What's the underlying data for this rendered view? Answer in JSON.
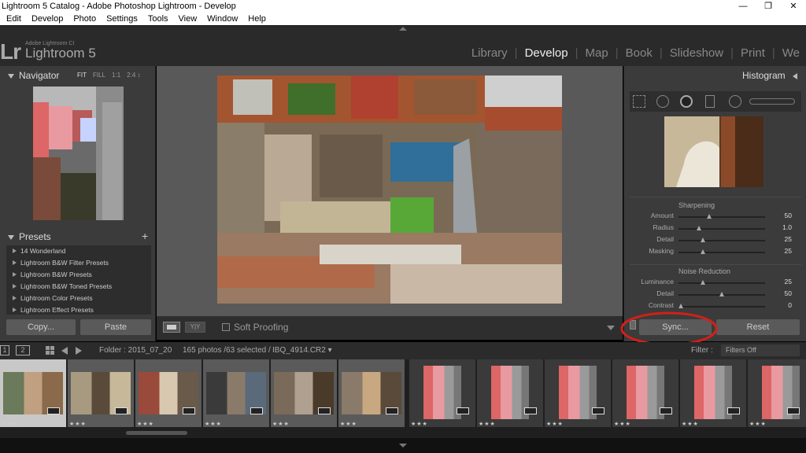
{
  "window": {
    "title": "Lightroom 5 Catalog - Adobe Photoshop Lightroom - Develop",
    "minimize": "—",
    "maximize": "❐",
    "close": "✕"
  },
  "menu": [
    "Edit",
    "Develop",
    "Photo",
    "Settings",
    "Tools",
    "View",
    "Window",
    "Help"
  ],
  "app": {
    "logo": "Lr",
    "small": "Adobe Lightroom CI",
    "name": "Lightroom 5"
  },
  "modules": [
    {
      "label": "Library",
      "active": false
    },
    {
      "label": "Develop",
      "active": true
    },
    {
      "label": "Map",
      "active": false
    },
    {
      "label": "Book",
      "active": false
    },
    {
      "label": "Slideshow",
      "active": false
    },
    {
      "label": "Print",
      "active": false
    },
    {
      "label": "We",
      "active": false
    }
  ],
  "navigator": {
    "title": "Navigator",
    "zoom": [
      "FIT",
      "FILL",
      "1:1",
      "2:4 ↕"
    ]
  },
  "presets": {
    "title": "Presets",
    "add": "+",
    "items": [
      "14 Wonderland",
      "Lightroom B&W Filter Presets",
      "Lightroom B&W Presets",
      "Lightroom B&W Toned Presets",
      "Lightroom Color Presets",
      "Lightroom Effect Presets"
    ]
  },
  "left_buttons": {
    "copy": "Copy...",
    "paste": "Paste"
  },
  "toolbar": {
    "soft_proofing": "Soft Proofing",
    "yy": "Y|Y"
  },
  "right": {
    "histogram": "Histogram",
    "sharpening_title": "Sharpening",
    "sharpening": [
      {
        "label": "Amount",
        "value": "50",
        "pos": 0.35
      },
      {
        "label": "Radius",
        "value": "1.0",
        "pos": 0.22
      },
      {
        "label": "Detail",
        "value": "25",
        "pos": 0.27
      },
      {
        "label": "Masking",
        "value": "25",
        "pos": 0.27
      }
    ],
    "noise_title": "Noise Reduction",
    "noise": [
      {
        "label": "Luminance",
        "value": "25",
        "pos": 0.27
      },
      {
        "label": "Detail",
        "value": "50",
        "pos": 0.5
      },
      {
        "label": "Contrast",
        "value": "0",
        "pos": 0.0
      }
    ],
    "sync": "Sync...",
    "reset": "Reset"
  },
  "filmbar": {
    "page1": "1",
    "page2": "2",
    "folder": "Folder : 2015_07_20",
    "count": "165 photos /63 selected /",
    "file": "IBQ_4914.CR2 ▾",
    "filter_label": "Filter :",
    "filter_value": "Filters Off"
  },
  "film_stars": "★★★",
  "colors": {
    "accent_red": "#d0201a",
    "panel": "#3b3b3b",
    "center": "#595959"
  }
}
